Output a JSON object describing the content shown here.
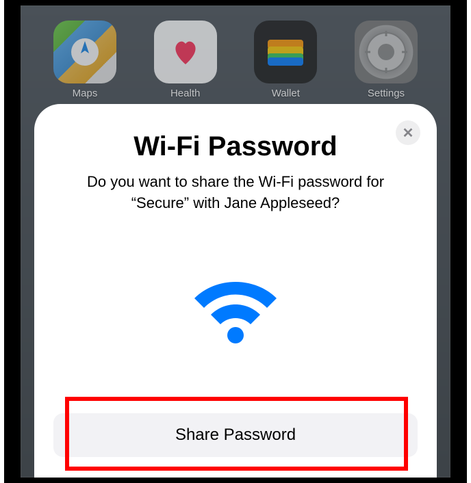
{
  "home": {
    "apps": [
      {
        "name": "maps",
        "label": "Maps"
      },
      {
        "name": "health",
        "label": "Health"
      },
      {
        "name": "wallet",
        "label": "Wallet"
      },
      {
        "name": "settings",
        "label": "Settings"
      }
    ]
  },
  "modal": {
    "title": "Wi-Fi Password",
    "subtitle": "Do you want to share the Wi-Fi password for “Secure” with Jane Appleseed?",
    "close_label": "✕",
    "share_button_label": "Share Password"
  }
}
